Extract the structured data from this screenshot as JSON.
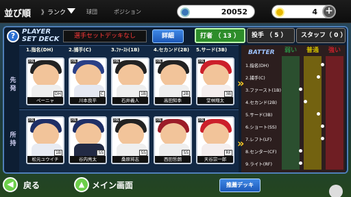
{
  "topbar": {
    "sort_label": "並び順",
    "sort_key": "》ランク",
    "filters": [
      "球団",
      "ポジション"
    ],
    "coins": "20052",
    "gold": "4",
    "plus": "+"
  },
  "deck": {
    "title_line1": "PLAYER",
    "title_line2": "SET DECK",
    "name": "選手セットデッキなし",
    "detail_button": "詳細",
    "help": "?"
  },
  "tabs": {
    "batter": "打者 （ 13 ）",
    "pitcher": "投手 （ 5 ）",
    "staff": "スタッフ（ 0 ）"
  },
  "side_labels": {
    "starters": "先発",
    "bench": "所持"
  },
  "starters": [
    {
      "slot": "1.指名(DH)",
      "name": "ペーニャ",
      "pos": "DH",
      "cap": "#222222",
      "body": "#eeeeee"
    },
    {
      "slot": "2.捕手(C)",
      "name": "川本良平",
      "pos": "C",
      "cap": "#2a3f86",
      "body": "#e5e8f2"
    },
    {
      "slot": "3.ﾌｧｰｽﾄ(1B)",
      "name": "石井義人",
      "pos": "1B",
      "cap": "#222222",
      "body": "#eeeeee"
    },
    {
      "slot": "4.セカンド(2B)",
      "name": "高田知季",
      "pos": "2B",
      "cap": "#222222",
      "body": "#eeeeee"
    },
    {
      "slot": "5.サード(3B)",
      "name": "堂林翔太",
      "pos": "3B",
      "cap": "#cc1f2a",
      "body": "#f4eeee"
    }
  ],
  "bench": [
    {
      "name": "松元ユウイチ",
      "pos": "1B",
      "cap": "#1f2f66",
      "body": "#e8ebf2"
    },
    {
      "name": "谷内亮太",
      "pos": "SS",
      "cap": "#1f2f66",
      "body": "#222a44"
    },
    {
      "name": "桑原将志",
      "pos": "SS",
      "cap": "#222222",
      "body": "#efefef"
    },
    {
      "name": "西田哲朗",
      "pos": "SS",
      "cap": "#9c1c28",
      "body": "#eeeeee"
    },
    {
      "name": "天谷宗一郎",
      "pos": "RF",
      "cap": "#cc1f2a",
      "body": "#f4eeee"
    }
  ],
  "batter_panel": {
    "title": "BATTER",
    "columns": [
      "弱い",
      "普通",
      "強い"
    ],
    "column_colors": [
      "#2b8c45",
      "#c9b600",
      "#c0202a"
    ],
    "order": [
      {
        "label": "1.指名(DH)",
        "level": 0.62
      },
      {
        "label": "2.捕手(C)",
        "level": 0.55
      },
      {
        "label": "3.ファースト(1B)",
        "level": 0.28
      },
      {
        "label": "4.セカンド(2B)",
        "level": 0.35
      },
      {
        "label": "5.サード(3B)",
        "level": 0.55
      },
      {
        "label": "6.ショート(SS)",
        "level": 0.62
      },
      {
        "label": "7.レフト(LF)",
        "level": 0.62
      },
      {
        "label": "8.センター(CF)",
        "level": 0.28
      },
      {
        "label": "9.ライト(RF)",
        "level": 0.28
      }
    ]
  },
  "bottom": {
    "back_label": "戻る",
    "home_label": "メイン画面",
    "recommend": "推薦デッキ"
  }
}
